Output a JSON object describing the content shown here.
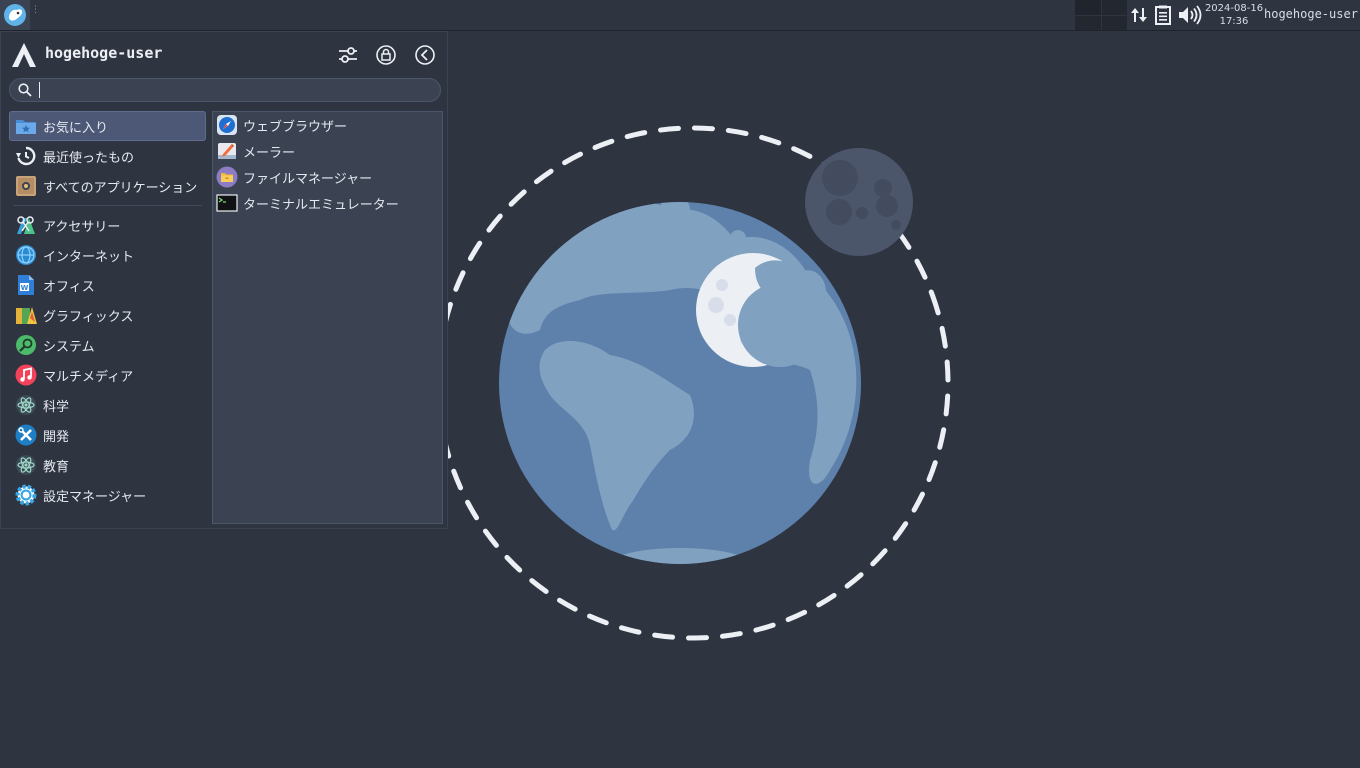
{
  "panel": {
    "clock_date": "2024-08-16",
    "clock_time": "17:36",
    "user": "hogehoge-user",
    "tray_icons": [
      "network-icon",
      "clipboard-icon",
      "volume-icon"
    ]
  },
  "menu": {
    "username": "hogehoge-user",
    "header_buttons": [
      "settings-icon",
      "lock-screen-icon",
      "logout-icon"
    ],
    "search": {
      "value": "",
      "placeholder": ""
    },
    "categories_top": [
      {
        "label": "お気に入り",
        "icon": "favorites-folder-icon",
        "selected": true
      },
      {
        "label": "最近使ったもの",
        "icon": "recent-history-icon",
        "selected": false
      },
      {
        "label": "すべてのアプリケーション",
        "icon": "all-applications-icon",
        "selected": false
      }
    ],
    "categories": [
      {
        "label": "アクセサリー",
        "icon": "accessories-icon"
      },
      {
        "label": "インターネット",
        "icon": "internet-globe-icon"
      },
      {
        "label": "オフィス",
        "icon": "office-document-icon"
      },
      {
        "label": "グラフィックス",
        "icon": "graphics-icon"
      },
      {
        "label": "システム",
        "icon": "system-search-icon"
      },
      {
        "label": "マルチメディア",
        "icon": "multimedia-music-icon"
      },
      {
        "label": "科学",
        "icon": "science-atom-icon"
      },
      {
        "label": "開発",
        "icon": "development-tools-icon"
      },
      {
        "label": "教育",
        "icon": "education-atom-icon"
      },
      {
        "label": "設定マネージャー",
        "icon": "settings-manager-icon"
      }
    ],
    "apps": [
      {
        "label": "ウェブブラウザー",
        "icon": "web-browser-icon"
      },
      {
        "label": "メーラー",
        "icon": "mail-client-icon"
      },
      {
        "label": "ファイルマネージャー",
        "icon": "file-manager-icon"
      },
      {
        "label": "ターミナルエミュレーター",
        "icon": "terminal-icon"
      }
    ]
  },
  "colors": {
    "desktop_bg": "#2e3440",
    "earth_ocean": "#5e81ac",
    "earth_land": "#81a1c1",
    "selected_bg": "#4c5875"
  }
}
